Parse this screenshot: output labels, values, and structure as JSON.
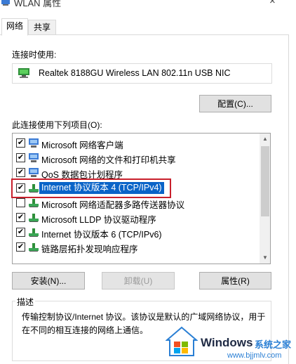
{
  "window": {
    "title": "WLAN 属性",
    "close_glyph": "×"
  },
  "tabs": [
    {
      "label": "网络",
      "active": true
    },
    {
      "label": "共享",
      "active": false
    }
  ],
  "connect_using": {
    "label": "连接时使用:",
    "adapter": "Realtek 8188GU Wireless LAN 802.11n USB NIC",
    "adapter_icon": "network-adapter-icon",
    "configure_button": "配置(C)..."
  },
  "items_section": {
    "label": "此连接使用下列项目(O):",
    "items": [
      {
        "label": "Microsoft 网络客户端",
        "checked": true,
        "icon": "network-client-icon"
      },
      {
        "label": "Microsoft 网络的文件和打印机共享",
        "checked": true,
        "icon": "network-client-icon"
      },
      {
        "label": "QoS 数据包计划程序",
        "checked": true,
        "icon": "network-client-icon"
      },
      {
        "label": "Internet 协议版本 4 (TCP/IPv4)",
        "checked": true,
        "selected": true,
        "icon": "protocol-icon"
      },
      {
        "label": "Microsoft 网络适配器多路传送器协议",
        "checked": false,
        "icon": "protocol-icon"
      },
      {
        "label": "Microsoft LLDP 协议驱动程序",
        "checked": true,
        "icon": "protocol-icon"
      },
      {
        "label": "Internet 协议版本 6 (TCP/IPv6)",
        "checked": true,
        "icon": "protocol-icon"
      },
      {
        "label": "链路层拓扑发现响应程序",
        "checked": true,
        "icon": "protocol-icon"
      }
    ]
  },
  "action_buttons": {
    "install": "安装(N)...",
    "uninstall": "卸载(U)",
    "properties": "属性(R)"
  },
  "description": {
    "legend": "描述",
    "text": "传输控制协议/Internet 协议。该协议是默认的广域网络协议，用于在不同的相互连接的网络上通信。"
  },
  "watermark": {
    "brand": "Windows",
    "cn": "系统之家",
    "url": "www.bjjmlv.com"
  },
  "colors": {
    "selection": "#0a64c8",
    "highlight": "#c8202c",
    "accent": "#0078d7"
  }
}
